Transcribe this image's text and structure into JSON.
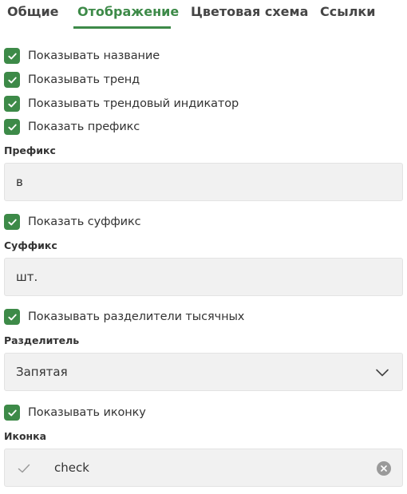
{
  "tabs": [
    {
      "label": "Общие",
      "active": false
    },
    {
      "label": "Отображение",
      "active": true
    },
    {
      "label": "Цветовая схема",
      "active": false
    },
    {
      "label": "Ссылки",
      "active": false
    }
  ],
  "options": {
    "show_title": {
      "label": "Показывать название",
      "checked": true
    },
    "show_trend": {
      "label": "Показывать тренд",
      "checked": true
    },
    "show_trend_indicator": {
      "label": "Показывать трендовый индикатор",
      "checked": true
    },
    "show_prefix": {
      "label": "Показать префикс",
      "checked": true
    },
    "show_suffix": {
      "label": "Показать суффикс",
      "checked": true
    },
    "show_thousands_separator": {
      "label": "Показывать разделители тысячных",
      "checked": true
    },
    "show_icon": {
      "label": "Показывать иконку",
      "checked": true
    }
  },
  "prefix": {
    "label": "Префикс",
    "value": "в"
  },
  "suffix": {
    "label": "Суффикс",
    "value": "шт."
  },
  "separator": {
    "label": "Разделитель",
    "selected": "Запятая"
  },
  "icon": {
    "label": "Иконка",
    "value": "check",
    "icon_name": "check-icon"
  },
  "colors": {
    "accent": "#3d8a48",
    "field_bg": "#f1f1f1",
    "text": "#333333"
  }
}
